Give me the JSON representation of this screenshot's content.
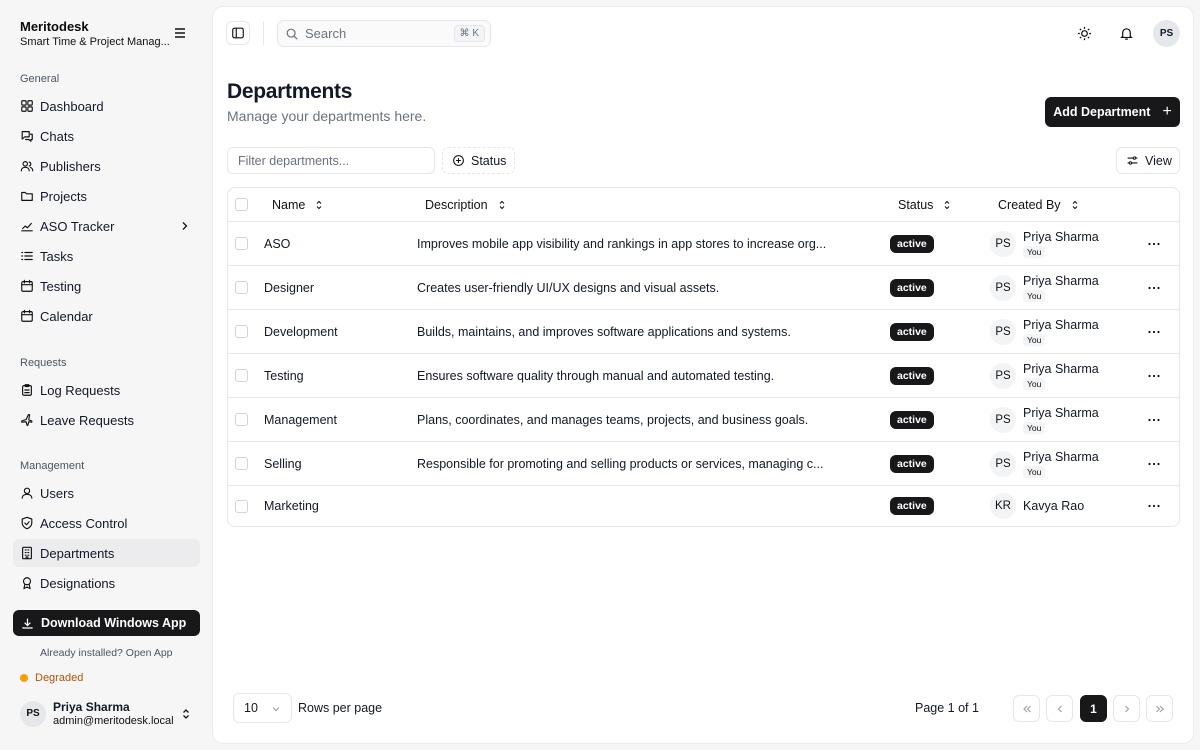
{
  "app": {
    "name": "Meritodesk",
    "subtitle": "Smart Time & Project Manag..."
  },
  "sidebar": {
    "general_label": "General",
    "general": [
      {
        "label": "Dashboard",
        "icon": "grid-icon"
      },
      {
        "label": "Chats",
        "icon": "chat-icon"
      },
      {
        "label": "Publishers",
        "icon": "users-icon"
      },
      {
        "label": "Projects",
        "icon": "folder-icon"
      },
      {
        "label": "ASO Tracker",
        "icon": "chart-icon"
      },
      {
        "label": "Tasks",
        "icon": "list-icon"
      },
      {
        "label": "Testing",
        "icon": "calendar-icon"
      },
      {
        "label": "Calendar",
        "icon": "calendar-icon"
      }
    ],
    "requests_label": "Requests",
    "requests": [
      {
        "label": "Log Requests",
        "icon": "clipboard-icon"
      },
      {
        "label": "Leave Requests",
        "icon": "plane-icon"
      }
    ],
    "management_label": "Management",
    "management": [
      {
        "label": "Users",
        "icon": "user-icon"
      },
      {
        "label": "Access Control",
        "icon": "shield-icon"
      },
      {
        "label": "Departments",
        "icon": "building-icon"
      },
      {
        "label": "Designations",
        "icon": "badge-icon"
      }
    ],
    "download_label": "Download Windows App",
    "installed_text": "Already installed? Open App",
    "status_text": "Degraded",
    "user": {
      "initials": "PS",
      "name": "Priya Sharma",
      "email": "admin@meritodesk.local"
    }
  },
  "topbar": {
    "search_placeholder": "Search",
    "shortcut": "⌘ K",
    "avatar_initials": "PS"
  },
  "page": {
    "title": "Departments",
    "subtitle": "Manage your departments here.",
    "add_button": "Add Department",
    "filter_placeholder": "Filter departments...",
    "status_filter": "Status",
    "view_button": "View"
  },
  "table": {
    "headers": {
      "name": "Name",
      "description": "Description",
      "status": "Status",
      "created_by": "Created By"
    },
    "rows": [
      {
        "name": "ASO",
        "description": "Improves mobile app visibility and rankings in app stores to increase org...",
        "status": "active",
        "initials": "PS",
        "creator": "Priya Sharma",
        "you": "You"
      },
      {
        "name": "Designer",
        "description": "Creates user-friendly UI/UX designs and visual assets.",
        "status": "active",
        "initials": "PS",
        "creator": "Priya Sharma",
        "you": "You"
      },
      {
        "name": "Development",
        "description": "Builds, maintains, and improves software applications and systems.",
        "status": "active",
        "initials": "PS",
        "creator": "Priya Sharma",
        "you": "You"
      },
      {
        "name": "Testing",
        "description": "Ensures software quality through manual and automated testing.",
        "status": "active",
        "initials": "PS",
        "creator": "Priya Sharma",
        "you": "You"
      },
      {
        "name": "Management",
        "description": "Plans, coordinates, and manages teams, projects, and business goals.",
        "status": "active",
        "initials": "PS",
        "creator": "Priya Sharma",
        "you": "You"
      },
      {
        "name": "Selling",
        "description": "Responsible for promoting and selling products or services, managing c...",
        "status": "active",
        "initials": "PS",
        "creator": "Priya Sharma",
        "you": "You"
      },
      {
        "name": "Marketing",
        "description": "",
        "status": "active",
        "initials": "KR",
        "creator": "Kavya Rao",
        "you": ""
      }
    ]
  },
  "pagination": {
    "rows_per_page_value": "10",
    "rows_per_page_label": "Rows per page",
    "page_info": "Page 1 of 1",
    "current_page": "1"
  }
}
